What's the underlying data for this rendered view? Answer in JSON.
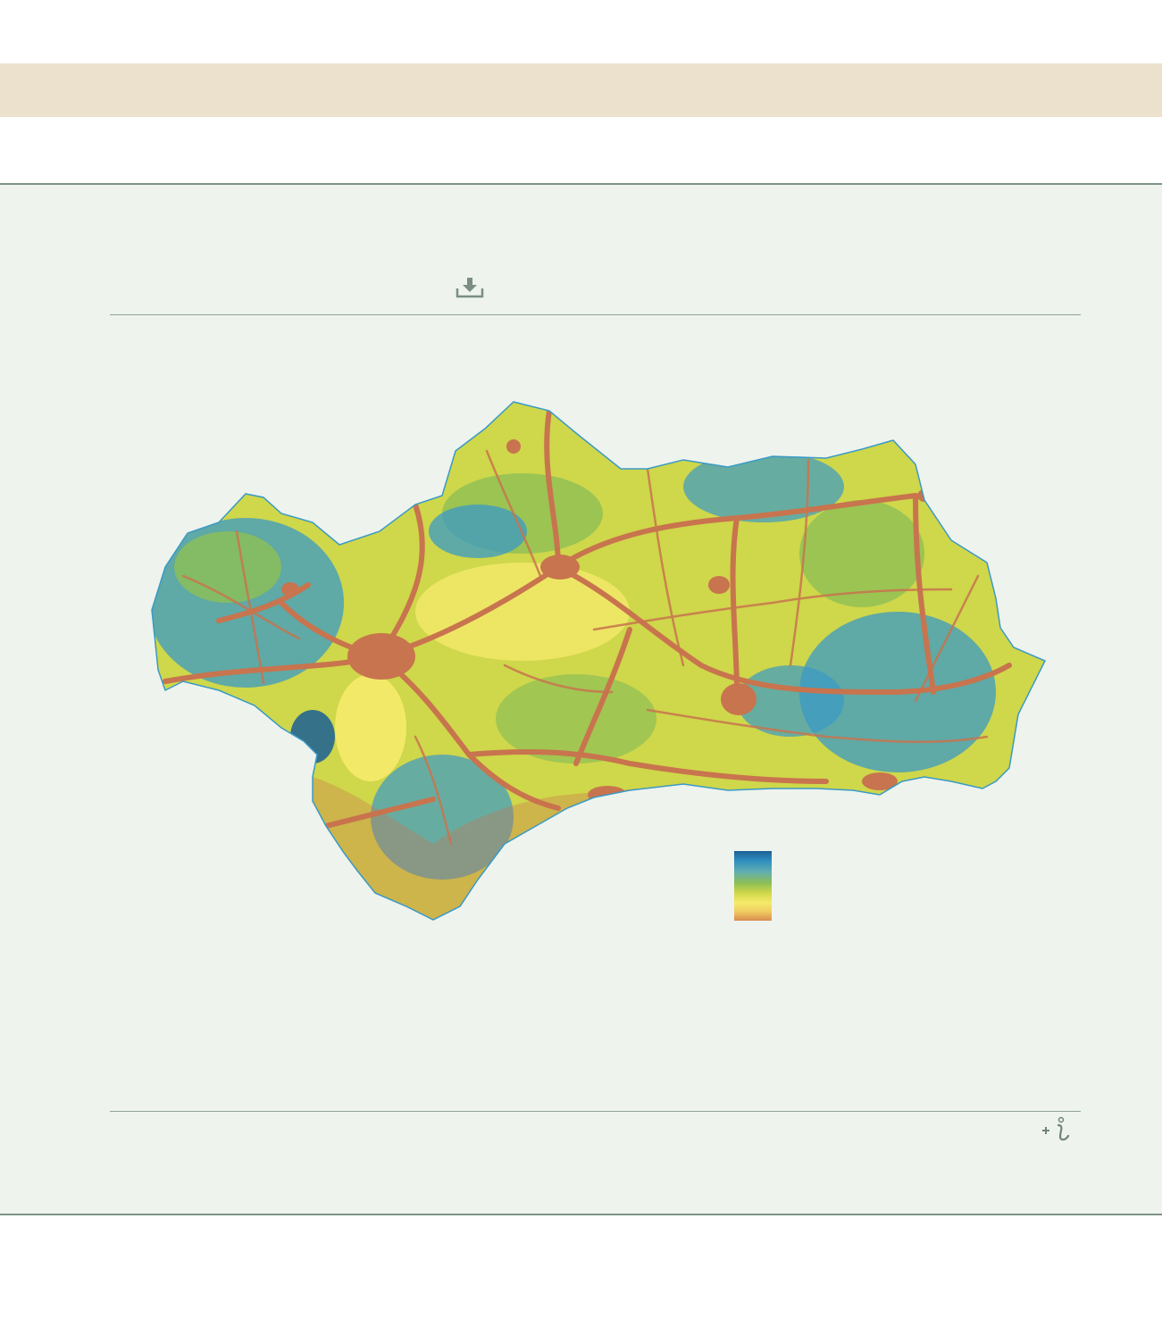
{
  "header": {
    "band_color": "#ebe1cd"
  },
  "panel": {
    "background": "#eef3ed",
    "border_color": "#7d9484"
  },
  "toolbar": {
    "download_icon": "download-icon"
  },
  "map": {
    "region": "Andalusia",
    "colors": {
      "urban_network": "#c8744e",
      "high": "#1b5f95",
      "mid_high": "#3a9ac6",
      "mid": "#8dbf55",
      "mid_low": "#cfd74a",
      "low": "#f4ea6a"
    }
  },
  "legend": {
    "gradient_stops": [
      "#1b5f95",
      "#2f8fbf",
      "#62aeb0",
      "#8dbf55",
      "#cfd74a",
      "#f4ea6a",
      "#f2cf63",
      "#d98d4f"
    ]
  },
  "footer": {
    "more_info_icon": "more-info-icon"
  }
}
